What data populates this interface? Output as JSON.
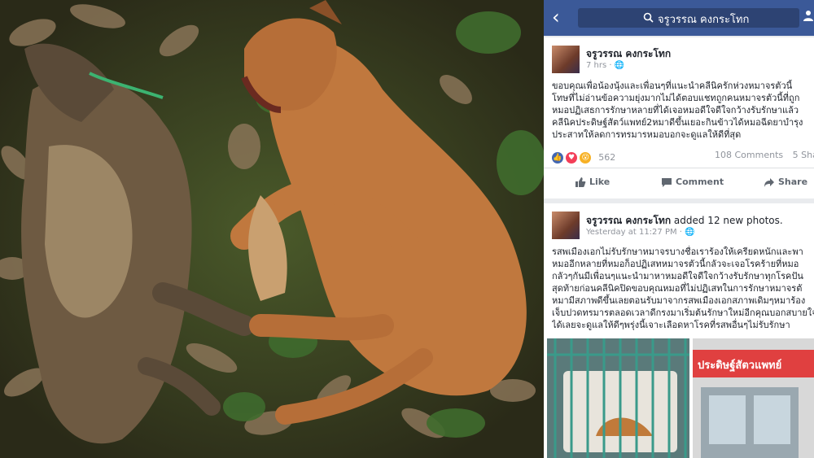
{
  "header": {
    "back_icon": "back-arrow-icon",
    "search_query": "จรูวรรณ คงกระโทก",
    "colors": {
      "bar": "#3b5998",
      "search_bg": "#2d4373"
    }
  },
  "post1": {
    "author": "จรูวรรณ คงกระโทก",
    "time": "7 hrs · ",
    "privacy_icon": "globe-icon",
    "lines": [
      "ขอบคุณเพื่อน้องนุ้งและเพื่อนๆที่แนะนำคลีนิครักห่วงหมาจรตัวนี้",
      "โทษที่ไม่อ่านข้อความยุ่งมากไม่ได้ตอบแชทถูกคนหมาจรตัวนี้ที่ถูก",
      "หมอปฏิเสธการรักษาหลายที่ได้เจอหมอดีใจดีใจกว้างรับรักษาแล้ว",
      "คลีนิคประดิษฐ์สัตว์แพทย์2หมาดีขึ้นเยอะกินข้าวได้หมอฉีดยาบำรุง",
      "ประสาทให้ลดการทรมารหมอบอกจะดูแลให้ดีที่สุด"
    ],
    "reactions": [
      "like",
      "love",
      "wow"
    ],
    "reaction_count": "562",
    "comments_text": "108 Comments",
    "shares_text": "5 Shares",
    "like_label": "Like",
    "comment_label": "Comment",
    "share_label": "Share"
  },
  "post2": {
    "author": "จรูวรรณ คงกระโทก",
    "action_text": " added 12 new photos.",
    "time": "Yesterday at 11:27 PM · ",
    "lines": [
      "รสพเมืองเอกไม่รับรักษาหมาจรบางชื่อเราร้องให้เครียดหนักและพา",
      "หมออีกหลายที่หมอก็อปฏิเสทหมาจรตัวนี้กลัวจะเจอโรคร้ายที่หมอ",
      "กลัวๆกันมีเพื่อนๆแนะนำมาหาหมอดีใจดีใจกว้างรับรักษาทุกโรคปัน",
      "สุดท้ายก่อนคลีนิคปิดขอบคุณหมอที่ไม่ปฏิเสทในการรักษาหมาจรตั",
      "หมามีสภาพดีขึ้นเลยตอนรับมาจากรสพเมืองเอกสภาพเดิมๆหมาร้อง",
      "เจ็บปวดทรมารตลอดเวลาดีกรงมาเริ่มต้นรักษาใหม่อีกคุณบอกสบายใจ",
      "ได้เลยจะดูแลให้ดีๆพรุ่งนี้เจาะเลือดหาโรคที่รสพอื่นๆไม่รับรักษา"
    ],
    "clinic_sign": "ประดิษฐ์สัตวแพทย์"
  }
}
